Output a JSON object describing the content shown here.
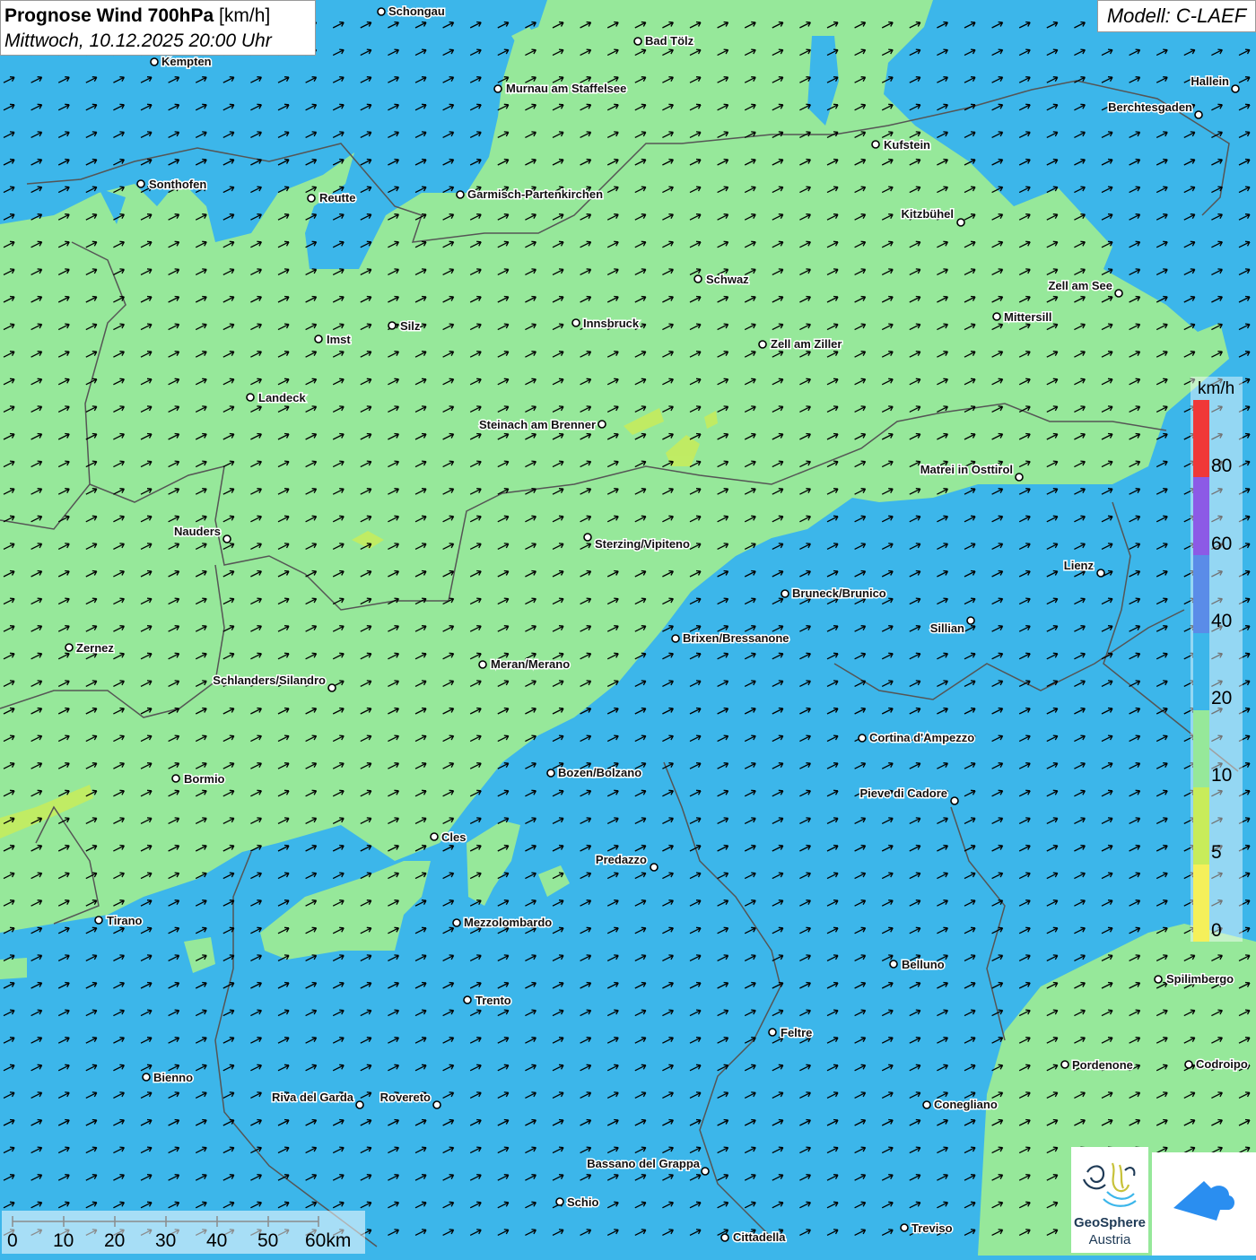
{
  "header": {
    "title_bold": "Prognose Wind 700hPa",
    "title_unit": "[km/h]",
    "subtitle": "Mittwoch, 10.12.2025 20:00 Uhr",
    "model": "Modell: C-LAEF"
  },
  "colors": {
    "wind_0_5": "#f5f05a",
    "wind_5_10": "#c8ec5a",
    "wind_10_20": "#96e89a",
    "wind_20_40": "#3cb6ea",
    "wind_40_60": "#5a8ce8",
    "wind_60_80": "#8c5ae6",
    "wind_80_plus": "#f03838",
    "borders": "#555555",
    "arrows": "#000000"
  },
  "legend": {
    "unit": "km/h",
    "ticks": [
      "0",
      "5",
      "10",
      "20",
      "40",
      "60",
      "80"
    ]
  },
  "wind": {
    "direction": "south-west to north-east",
    "background_speed_class": "20"
  },
  "scalebar": {
    "labels": [
      "0",
      "10",
      "20",
      "30",
      "40",
      "50",
      "60km"
    ]
  },
  "logos": {
    "geosphere_line1": "GeoSphere",
    "geosphere_line2": "Austria"
  },
  "cities": [
    {
      "name": "Schongau"
    },
    {
      "name": "Kempten"
    },
    {
      "name": "Bad Tölz"
    },
    {
      "name": "Murnau am Staffelsee"
    },
    {
      "name": "Hallein"
    },
    {
      "name": "Berchtesgaden"
    },
    {
      "name": "Kufstein"
    },
    {
      "name": "Sonthofen"
    },
    {
      "name": "Reutte"
    },
    {
      "name": "Garmisch-Partenkirchen"
    },
    {
      "name": "Kitzbühel"
    },
    {
      "name": "Schwaz"
    },
    {
      "name": "Zell am See"
    },
    {
      "name": "Mittersill"
    },
    {
      "name": "Innsbruck"
    },
    {
      "name": "Imst"
    },
    {
      "name": "Silz"
    },
    {
      "name": "Zell am Ziller"
    },
    {
      "name": "Landeck"
    },
    {
      "name": "Steinach am Brenner"
    },
    {
      "name": "Matrei in Osttirol"
    },
    {
      "name": "Nauders"
    },
    {
      "name": "Sterzing/Vipiteno"
    },
    {
      "name": "Lienz"
    },
    {
      "name": "Bruneck/Brunico"
    },
    {
      "name": "Sillian"
    },
    {
      "name": "Zernez"
    },
    {
      "name": "Brixen/Bressanone"
    },
    {
      "name": "Meran/Merano"
    },
    {
      "name": "Schlanders/Silandro"
    },
    {
      "name": "Cortina d'Ampezzo"
    },
    {
      "name": "Bozen/Bolzano"
    },
    {
      "name": "Bormio"
    },
    {
      "name": "Pieve di Cadore"
    },
    {
      "name": "Cles"
    },
    {
      "name": "Predazzo"
    },
    {
      "name": "Tirano"
    },
    {
      "name": "Mezzolombardo"
    },
    {
      "name": "Belluno"
    },
    {
      "name": "Spilimbergo"
    },
    {
      "name": "Trento"
    },
    {
      "name": "Feltre"
    },
    {
      "name": "Pordenone"
    },
    {
      "name": "Codroipo"
    },
    {
      "name": "Bienno"
    },
    {
      "name": "Riva del Garda"
    },
    {
      "name": "Rovereto"
    },
    {
      "name": "Conegliano"
    },
    {
      "name": "Bassano del Grappa"
    },
    {
      "name": "Schio"
    },
    {
      "name": "Treviso"
    },
    {
      "name": "Cittadella"
    }
  ]
}
